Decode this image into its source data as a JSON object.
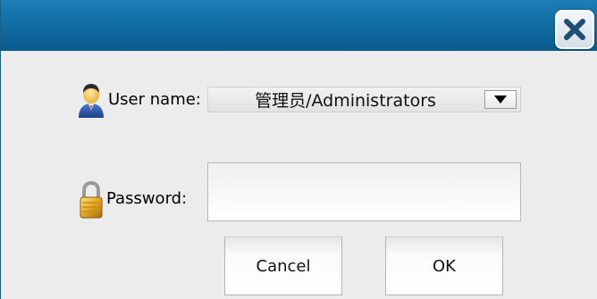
{
  "titlebar": {
    "close_icon": "close-icon",
    "color": "#126ea5"
  },
  "form": {
    "user_label": "User name:",
    "user_icon": "user-avatar-icon",
    "user_value": "管理员/Administrators",
    "dropdown_icon": "triangle-down-icon",
    "password_label": "Password:",
    "password_icon": "padlock-icon",
    "password_value": ""
  },
  "buttons": {
    "cancel_label": "Cancel",
    "ok_label": "OK"
  }
}
